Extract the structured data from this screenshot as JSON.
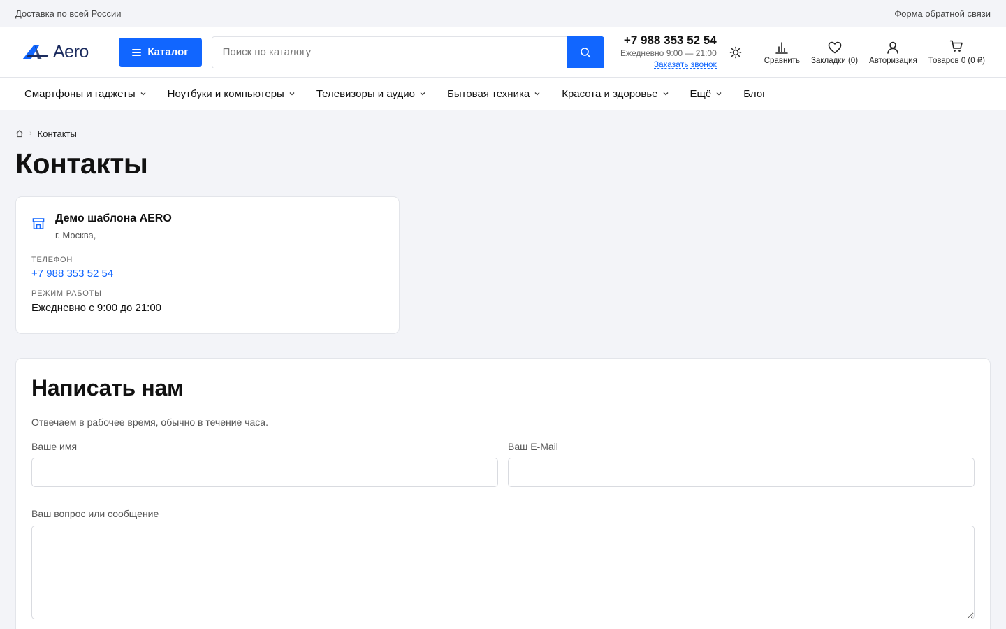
{
  "topbar": {
    "delivery": "Доставка по всей России",
    "feedback": "Форма обратной связи"
  },
  "header": {
    "logo_text": "Aero",
    "catalog_label": "Каталог",
    "search_placeholder": "Поиск по каталогу",
    "phone": "+7 988 353 52 54",
    "hours": "Ежедневно 9:00 — 21:00",
    "callback": "Заказать звонок",
    "actions": {
      "compare": "Сравнить",
      "bookmarks": "Закладки (0)",
      "login": "Авторизация",
      "cart": "Товаров 0 (0 ₽)"
    },
    "accent_color": "#1166ff"
  },
  "nav": {
    "items": [
      {
        "label": "Смартфоны и гаджеты",
        "has_dropdown": true
      },
      {
        "label": "Ноутбуки и компьютеры",
        "has_dropdown": true
      },
      {
        "label": "Телевизоры и аудио",
        "has_dropdown": true
      },
      {
        "label": "Бытовая техника",
        "has_dropdown": true
      },
      {
        "label": "Красота и здоровье",
        "has_dropdown": true
      },
      {
        "label": "Ещё",
        "has_dropdown": true
      },
      {
        "label": "Блог",
        "has_dropdown": false
      }
    ]
  },
  "breadcrumb": {
    "home_icon": "home-icon",
    "current": "Контакты"
  },
  "page": {
    "title": "Контакты"
  },
  "contact": {
    "store_icon": "store-icon",
    "name": "Демо шаблона AERO",
    "city": "г. Москва,",
    "phone_label": "Телефон",
    "phone": "+7 988 353 52 54",
    "hours_label": "Режим работы",
    "hours": "Ежедневно с 9:00 до 21:00"
  },
  "form": {
    "title": "Написать нам",
    "subtitle": "Отвечаем в рабочее время, обычно в течение часа.",
    "name_label": "Ваше имя",
    "name_value": "",
    "email_label": "Ваш E-Mail",
    "email_value": "",
    "message_label": "Ваш вопрос или сообщение",
    "message_value": ""
  }
}
